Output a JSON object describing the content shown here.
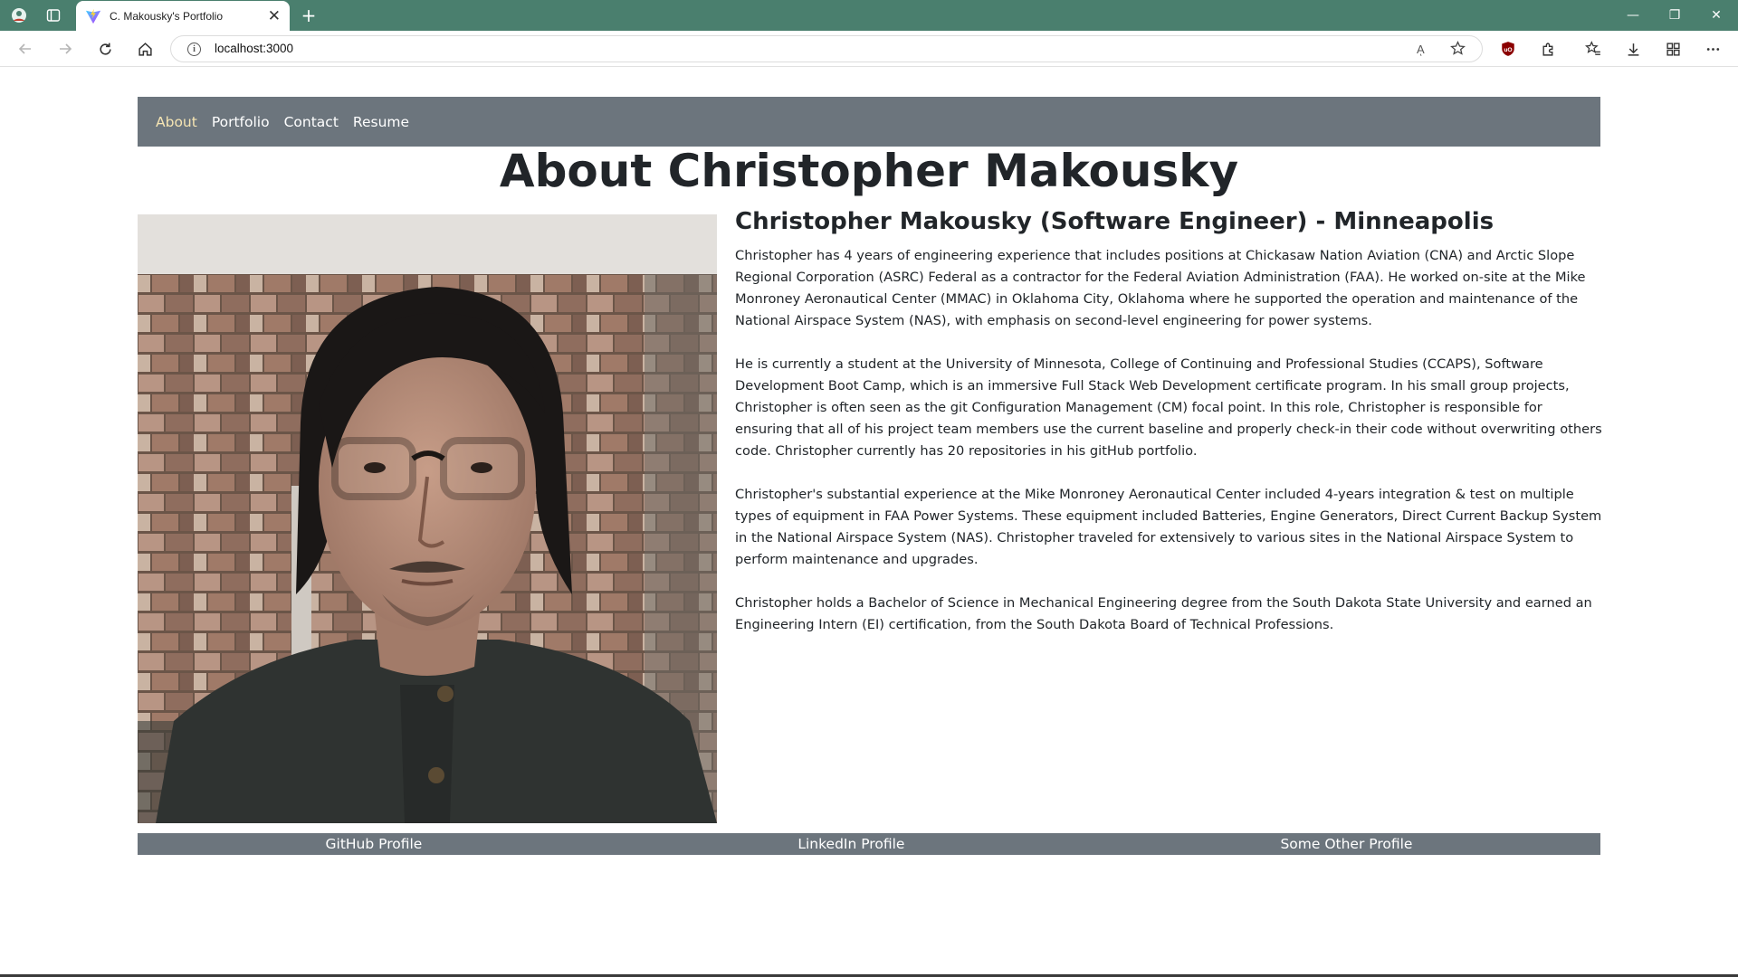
{
  "browser": {
    "tab_title": "C. Makousky's Portfolio",
    "tab_close": "✕",
    "new_tab": "+",
    "url": "localhost:3000",
    "read_aloud": "Aͅ",
    "window": {
      "minimize": "—",
      "restore": "❐",
      "close": "✕"
    }
  },
  "nav": {
    "items": [
      {
        "label": "About",
        "active": true
      },
      {
        "label": "Portfolio",
        "active": false
      },
      {
        "label": "Contact",
        "active": false
      },
      {
        "label": "Resume",
        "active": false
      }
    ]
  },
  "page_title": "About Christopher Makousky",
  "bio": {
    "heading": "Christopher Makousky (Software Engineer) - Minneapolis",
    "paragraphs": [
      "Christopher has 4 years of engineering experience that includes positions at Chickasaw Nation Aviation (CNA) and Arctic Slope Regional Corporation (ASRC) Federal as a contractor for the Federal Aviation Administration (FAA). He worked on-site at the Mike Monroney Aeronautical Center (MMAC) in Oklahoma City, Oklahoma where he supported the operation and maintenance of the National Airspace System (NAS), with emphasis on second-level engineering for power systems.",
      "He is currently a student at the University of Minnesota, College of Continuing and Professional Studies (CCAPS), Software Development Boot Camp, which is an immersive Full Stack Web Development certificate program. In his small group projects, Christopher is often seen as the git Configuration Management (CM) focal point. In this role, Christopher is responsible for ensuring that all of his project team members use the current baseline and properly check-in their code without overwriting others code. Christopher currently has 20 repositories in his gitHub portfolio.",
      "Christopher's substantial experience at the Mike Monroney Aeronautical Center included 4-years integration & test on multiple types of equipment in FAA Power Systems. These equipment included Batteries, Engine Generators, Direct Current Backup System in the National Airspace System (NAS). Christopher traveled for extensively to various sites in the National Airspace System to perform maintenance and upgrades.",
      "Christopher holds a Bachelor of Science in Mechanical Engineering degree from the South Dakota State University and earned an Engineering Intern (EI) certification, from the South Dakota Board of Technical Professions."
    ]
  },
  "footer": {
    "links": [
      "GitHub Profile",
      "LinkedIn Profile",
      "Some Other Profile"
    ]
  },
  "colors": {
    "tabbar": "#4a7f6e",
    "navbar": "#6c757d",
    "active_nav": "#f6e5b3"
  }
}
